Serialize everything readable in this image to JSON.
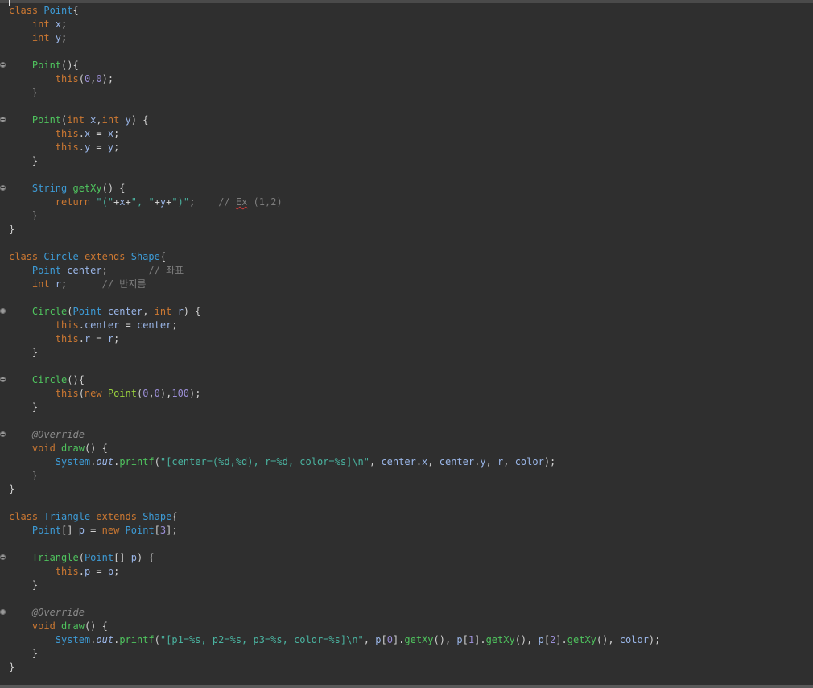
{
  "editor": {
    "lines": [
      {
        "fold": false,
        "tokens": [
          {
            "t": "class ",
            "c": "kw"
          },
          {
            "t": "Point",
            "c": "type"
          },
          {
            "t": "{",
            "c": "punc"
          }
        ]
      },
      {
        "fold": false,
        "tokens": [
          {
            "t": "    int ",
            "c": "kw"
          },
          {
            "t": "x",
            "c": "var"
          },
          {
            "t": ";",
            "c": "punc"
          }
        ]
      },
      {
        "fold": false,
        "tokens": [
          {
            "t": "    int ",
            "c": "kw"
          },
          {
            "t": "y",
            "c": "var"
          },
          {
            "t": ";",
            "c": "punc"
          }
        ]
      },
      {
        "fold": false,
        "tokens": []
      },
      {
        "fold": true,
        "tokens": [
          {
            "t": "    Point",
            "c": "ctor"
          },
          {
            "t": "(){",
            "c": "punc"
          }
        ]
      },
      {
        "fold": false,
        "tokens": [
          {
            "t": "        this",
            "c": "kw"
          },
          {
            "t": "(",
            "c": "punc"
          },
          {
            "t": "0",
            "c": "num"
          },
          {
            "t": ",",
            "c": "punc"
          },
          {
            "t": "0",
            "c": "num"
          },
          {
            "t": ");",
            "c": "punc"
          }
        ]
      },
      {
        "fold": false,
        "tokens": [
          {
            "t": "    }",
            "c": "punc"
          }
        ]
      },
      {
        "fold": false,
        "tokens": []
      },
      {
        "fold": true,
        "tokens": [
          {
            "t": "    Point",
            "c": "ctor"
          },
          {
            "t": "(",
            "c": "punc"
          },
          {
            "t": "int ",
            "c": "kw"
          },
          {
            "t": "x",
            "c": "var"
          },
          {
            "t": ",",
            "c": "punc"
          },
          {
            "t": "int ",
            "c": "kw"
          },
          {
            "t": "y",
            "c": "var"
          },
          {
            "t": ") {",
            "c": "punc"
          }
        ]
      },
      {
        "fold": false,
        "tokens": [
          {
            "t": "        this",
            "c": "kw"
          },
          {
            "t": ".",
            "c": "punc"
          },
          {
            "t": "x",
            "c": "var"
          },
          {
            "t": " = ",
            "c": "punc"
          },
          {
            "t": "x",
            "c": "var"
          },
          {
            "t": ";",
            "c": "punc"
          }
        ]
      },
      {
        "fold": false,
        "tokens": [
          {
            "t": "        this",
            "c": "kw"
          },
          {
            "t": ".",
            "c": "punc"
          },
          {
            "t": "y",
            "c": "var"
          },
          {
            "t": " = ",
            "c": "punc"
          },
          {
            "t": "y",
            "c": "var"
          },
          {
            "t": ";",
            "c": "punc"
          }
        ]
      },
      {
        "fold": false,
        "tokens": [
          {
            "t": "    }",
            "c": "punc"
          }
        ]
      },
      {
        "fold": false,
        "tokens": []
      },
      {
        "fold": true,
        "tokens": [
          {
            "t": "    String ",
            "c": "type"
          },
          {
            "t": "getXy",
            "c": "ctor"
          },
          {
            "t": "() {",
            "c": "punc"
          }
        ]
      },
      {
        "fold": false,
        "tokens": [
          {
            "t": "        return ",
            "c": "kw"
          },
          {
            "t": "\"(\"",
            "c": "str"
          },
          {
            "t": "+",
            "c": "punc"
          },
          {
            "t": "x",
            "c": "var"
          },
          {
            "t": "+",
            "c": "punc"
          },
          {
            "t": "\", \"",
            "c": "str"
          },
          {
            "t": "+",
            "c": "punc"
          },
          {
            "t": "y",
            "c": "var"
          },
          {
            "t": "+",
            "c": "punc"
          },
          {
            "t": "\")\"",
            "c": "str"
          },
          {
            "t": ";    ",
            "c": "punc"
          },
          {
            "t": "// ",
            "c": "cmt"
          },
          {
            "t": "Ex",
            "c": "cmt",
            "u": true
          },
          {
            "t": " (1,2)",
            "c": "cmt"
          }
        ]
      },
      {
        "fold": false,
        "tokens": [
          {
            "t": "    }",
            "c": "punc"
          }
        ]
      },
      {
        "fold": false,
        "tokens": [
          {
            "t": "}",
            "c": "punc"
          }
        ]
      },
      {
        "fold": false,
        "tokens": []
      },
      {
        "fold": false,
        "tokens": [
          {
            "t": "class ",
            "c": "kw"
          },
          {
            "t": "Circle ",
            "c": "type"
          },
          {
            "t": "extends ",
            "c": "kw"
          },
          {
            "t": "Shape",
            "c": "type"
          },
          {
            "t": "{",
            "c": "punc"
          }
        ]
      },
      {
        "fold": false,
        "tokens": [
          {
            "t": "    Point ",
            "c": "type"
          },
          {
            "t": "center",
            "c": "var"
          },
          {
            "t": ";       ",
            "c": "punc"
          },
          {
            "t": "// 좌표",
            "c": "cmt"
          }
        ]
      },
      {
        "fold": false,
        "tokens": [
          {
            "t": "    int ",
            "c": "kw"
          },
          {
            "t": "r",
            "c": "var"
          },
          {
            "t": ";      ",
            "c": "punc"
          },
          {
            "t": "// 반지름",
            "c": "cmt"
          }
        ]
      },
      {
        "fold": false,
        "tokens": []
      },
      {
        "fold": true,
        "tokens": [
          {
            "t": "    Circle",
            "c": "ctor"
          },
          {
            "t": "(",
            "c": "punc"
          },
          {
            "t": "Point ",
            "c": "type"
          },
          {
            "t": "center",
            "c": "var"
          },
          {
            "t": ", ",
            "c": "punc"
          },
          {
            "t": "int ",
            "c": "kw"
          },
          {
            "t": "r",
            "c": "var"
          },
          {
            "t": ") {",
            "c": "punc"
          }
        ]
      },
      {
        "fold": false,
        "tokens": [
          {
            "t": "        this",
            "c": "kw"
          },
          {
            "t": ".",
            "c": "punc"
          },
          {
            "t": "center",
            "c": "var"
          },
          {
            "t": " = ",
            "c": "punc"
          },
          {
            "t": "center",
            "c": "var"
          },
          {
            "t": ";",
            "c": "punc"
          }
        ]
      },
      {
        "fold": false,
        "tokens": [
          {
            "t": "        this",
            "c": "kw"
          },
          {
            "t": ".",
            "c": "punc"
          },
          {
            "t": "r",
            "c": "var"
          },
          {
            "t": " = ",
            "c": "punc"
          },
          {
            "t": "r",
            "c": "var"
          },
          {
            "t": ";",
            "c": "punc"
          }
        ]
      },
      {
        "fold": false,
        "tokens": [
          {
            "t": "    }",
            "c": "punc"
          }
        ]
      },
      {
        "fold": false,
        "tokens": []
      },
      {
        "fold": true,
        "tokens": [
          {
            "t": "    Circle",
            "c": "ctor"
          },
          {
            "t": "(){",
            "c": "punc"
          }
        ]
      },
      {
        "fold": false,
        "tokens": [
          {
            "t": "        this",
            "c": "kw"
          },
          {
            "t": "(",
            "c": "punc"
          },
          {
            "t": "new ",
            "c": "kw"
          },
          {
            "t": "Point",
            "c": "fn"
          },
          {
            "t": "(",
            "c": "punc"
          },
          {
            "t": "0",
            "c": "num"
          },
          {
            "t": ",",
            "c": "punc"
          },
          {
            "t": "0",
            "c": "num"
          },
          {
            "t": "),",
            "c": "punc"
          },
          {
            "t": "100",
            "c": "num"
          },
          {
            "t": ");",
            "c": "punc"
          }
        ]
      },
      {
        "fold": false,
        "tokens": [
          {
            "t": "    }",
            "c": "punc"
          }
        ]
      },
      {
        "fold": false,
        "tokens": []
      },
      {
        "fold": true,
        "tokens": [
          {
            "t": "    @Override",
            "c": "ann"
          }
        ]
      },
      {
        "fold": false,
        "tokens": [
          {
            "t": "    void ",
            "c": "kw"
          },
          {
            "t": "draw",
            "c": "ctor"
          },
          {
            "t": "() {",
            "c": "punc"
          }
        ]
      },
      {
        "fold": false,
        "tokens": [
          {
            "t": "        System",
            "c": "type"
          },
          {
            "t": ".",
            "c": "punc"
          },
          {
            "t": "out",
            "c": "field"
          },
          {
            "t": ".",
            "c": "punc"
          },
          {
            "t": "printf",
            "c": "call"
          },
          {
            "t": "(",
            "c": "punc"
          },
          {
            "t": "\"[center=(%d,%d), r=%d, color=%s]\\n\"",
            "c": "str"
          },
          {
            "t": ", ",
            "c": "punc"
          },
          {
            "t": "center",
            "c": "var"
          },
          {
            "t": ".",
            "c": "punc"
          },
          {
            "t": "x",
            "c": "var"
          },
          {
            "t": ", ",
            "c": "punc"
          },
          {
            "t": "center",
            "c": "var"
          },
          {
            "t": ".",
            "c": "punc"
          },
          {
            "t": "y",
            "c": "var"
          },
          {
            "t": ", ",
            "c": "punc"
          },
          {
            "t": "r",
            "c": "var"
          },
          {
            "t": ", ",
            "c": "punc"
          },
          {
            "t": "color",
            "c": "var"
          },
          {
            "t": ");",
            "c": "punc"
          }
        ]
      },
      {
        "fold": false,
        "tokens": [
          {
            "t": "    }",
            "c": "punc"
          }
        ]
      },
      {
        "fold": false,
        "tokens": [
          {
            "t": "}",
            "c": "punc"
          }
        ]
      },
      {
        "fold": false,
        "tokens": []
      },
      {
        "fold": false,
        "tokens": [
          {
            "t": "class ",
            "c": "kw"
          },
          {
            "t": "Triangle ",
            "c": "type"
          },
          {
            "t": "extends ",
            "c": "kw"
          },
          {
            "t": "Shape",
            "c": "type"
          },
          {
            "t": "{",
            "c": "punc"
          }
        ]
      },
      {
        "fold": false,
        "tokens": [
          {
            "t": "    Point",
            "c": "type"
          },
          {
            "t": "[] ",
            "c": "punc"
          },
          {
            "t": "p",
            "c": "var"
          },
          {
            "t": " = ",
            "c": "punc"
          },
          {
            "t": "new ",
            "c": "kw"
          },
          {
            "t": "Point",
            "c": "type"
          },
          {
            "t": "[",
            "c": "punc"
          },
          {
            "t": "3",
            "c": "num"
          },
          {
            "t": "];",
            "c": "punc"
          }
        ]
      },
      {
        "fold": false,
        "tokens": []
      },
      {
        "fold": true,
        "tokens": [
          {
            "t": "    Triangle",
            "c": "ctor"
          },
          {
            "t": "(",
            "c": "punc"
          },
          {
            "t": "Point",
            "c": "type"
          },
          {
            "t": "[] ",
            "c": "punc"
          },
          {
            "t": "p",
            "c": "var"
          },
          {
            "t": ") {",
            "c": "punc"
          }
        ]
      },
      {
        "fold": false,
        "tokens": [
          {
            "t": "        this",
            "c": "kw"
          },
          {
            "t": ".",
            "c": "punc"
          },
          {
            "t": "p",
            "c": "var"
          },
          {
            "t": " = ",
            "c": "punc"
          },
          {
            "t": "p",
            "c": "var"
          },
          {
            "t": ";",
            "c": "punc"
          }
        ]
      },
      {
        "fold": false,
        "tokens": [
          {
            "t": "    }",
            "c": "punc"
          }
        ]
      },
      {
        "fold": false,
        "tokens": []
      },
      {
        "fold": true,
        "tokens": [
          {
            "t": "    @Override",
            "c": "ann"
          }
        ]
      },
      {
        "fold": false,
        "tokens": [
          {
            "t": "    void ",
            "c": "kw"
          },
          {
            "t": "draw",
            "c": "ctor"
          },
          {
            "t": "() {",
            "c": "punc"
          }
        ]
      },
      {
        "fold": false,
        "tokens": [
          {
            "t": "        System",
            "c": "type"
          },
          {
            "t": ".",
            "c": "punc"
          },
          {
            "t": "out",
            "c": "field"
          },
          {
            "t": ".",
            "c": "punc"
          },
          {
            "t": "printf",
            "c": "call"
          },
          {
            "t": "(",
            "c": "punc"
          },
          {
            "t": "\"[p1=%s, p2=%s, p3=%s, color=%s]\\n\"",
            "c": "str"
          },
          {
            "t": ", ",
            "c": "punc"
          },
          {
            "t": "p",
            "c": "var"
          },
          {
            "t": "[",
            "c": "punc"
          },
          {
            "t": "0",
            "c": "num"
          },
          {
            "t": "].",
            "c": "punc"
          },
          {
            "t": "getXy",
            "c": "call"
          },
          {
            "t": "(), ",
            "c": "punc"
          },
          {
            "t": "p",
            "c": "var"
          },
          {
            "t": "[",
            "c": "punc"
          },
          {
            "t": "1",
            "c": "num"
          },
          {
            "t": "].",
            "c": "punc"
          },
          {
            "t": "getXy",
            "c": "call"
          },
          {
            "t": "(), ",
            "c": "punc"
          },
          {
            "t": "p",
            "c": "var"
          },
          {
            "t": "[",
            "c": "punc"
          },
          {
            "t": "2",
            "c": "num"
          },
          {
            "t": "].",
            "c": "punc"
          },
          {
            "t": "getXy",
            "c": "call"
          },
          {
            "t": "(), ",
            "c": "punc"
          },
          {
            "t": "color",
            "c": "var"
          },
          {
            "t": ");",
            "c": "punc"
          }
        ]
      },
      {
        "fold": false,
        "tokens": [
          {
            "t": "    }",
            "c": "punc"
          }
        ]
      },
      {
        "fold": false,
        "tokens": [
          {
            "t": "}",
            "c": "punc"
          }
        ]
      }
    ]
  },
  "colors": {
    "background": "#2f2f2f",
    "keyword": "#cc7832",
    "type": "#3d9bd6",
    "method_decl": "#4fc45e",
    "variable": "#9ab6e8",
    "string": "#4ab3a0",
    "number": "#9c8fd8",
    "comment": "#7d7d7d"
  },
  "icons": {
    "fold": "collapse-fold-icon"
  }
}
